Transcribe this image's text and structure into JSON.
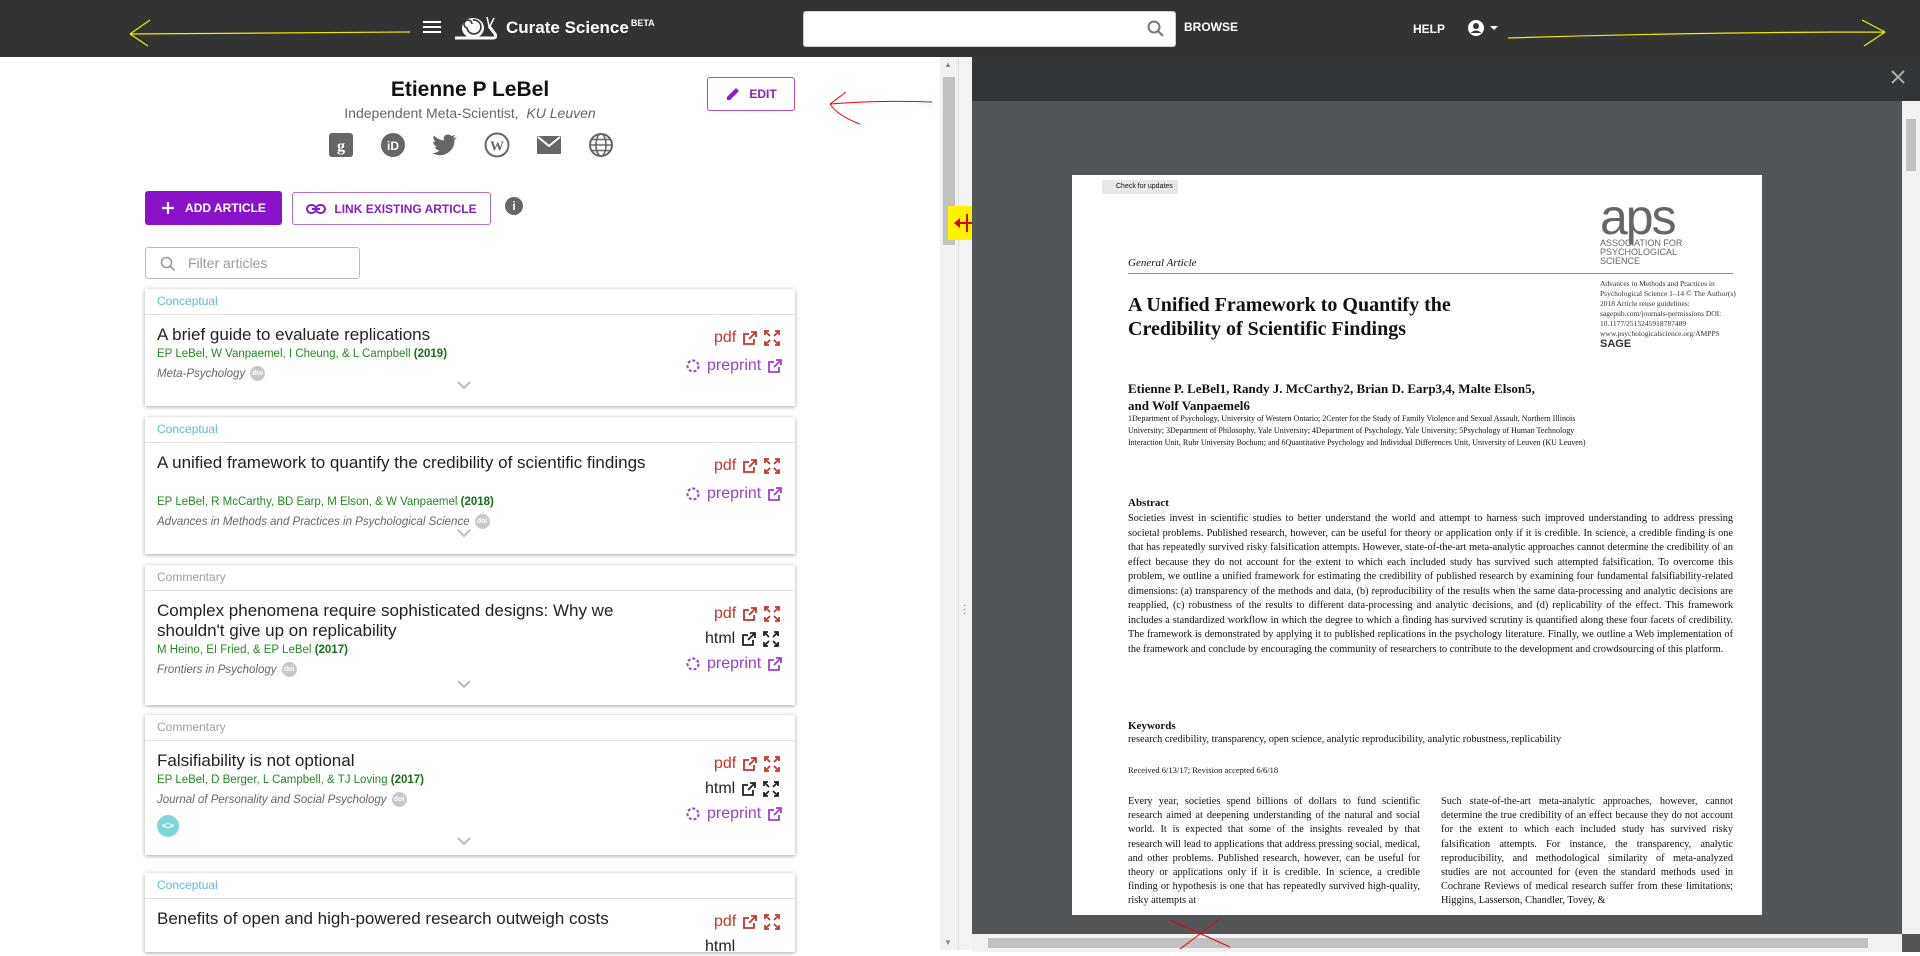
{
  "app": {
    "brand_name": "Curate Science",
    "brand_badge": "BETA",
    "search": {
      "value": "",
      "placeholder": ""
    },
    "browse_label": "BROWSE",
    "help_label": "HELP"
  },
  "profile": {
    "name": "Etienne P LeBel",
    "title": "Independent Meta-Scientist,",
    "institution": "KU Leuven",
    "edit_label": "EDIT",
    "social_icons": [
      "google-scholar-icon",
      "orcid-icon",
      "twitter-icon",
      "wordpress-icon",
      "email-icon",
      "website-globe-icon"
    ]
  },
  "actions": {
    "add_article": "ADD ARTICLE",
    "link_existing": "LINK EXISTING ARTICLE",
    "filter_placeholder": "Filter articles"
  },
  "colors": {
    "topbar": "#333333",
    "accent_purple": "#8a12c9",
    "type_conceptual": "#5bc0de",
    "type_commentary": "#9e9e9e",
    "authors_green": "#228b22",
    "pdf_red": "#c0392b",
    "preprint_purple": "#9b3fd0",
    "splitter_handle": "#fff200",
    "viewer_bg": "#525659"
  },
  "articles": [
    {
      "type": "Conceptual",
      "title": "A brief guide to evaluate replications",
      "authors": "EP LeBel, W Vanpaemel, I Cheung, & L Campbell",
      "year": "(2019)",
      "journal": "Meta-Psychology",
      "links": [
        "pdf",
        "preprint"
      ]
    },
    {
      "type": "Conceptual",
      "title": "A unified framework to quantify the credibility of scientific findings",
      "authors": "EP LeBel, R McCarthy, BD Earp, M Elson, & W Vanpaemel",
      "year": "(2018)",
      "journal": "Advances in Methods and Practices in Psychological Science",
      "links": [
        "pdf",
        "preprint"
      ]
    },
    {
      "type": "Commentary",
      "title": "Complex phenomena require sophisticated designs: Why we shouldn't give up on replicability",
      "authors": "M Heino, EI Fried, & EP LeBel",
      "year": "(2017)",
      "journal": "Frontiers in Psychology",
      "links": [
        "pdf",
        "html",
        "preprint"
      ]
    },
    {
      "type": "Commentary",
      "title": "Falsifiability is not optional",
      "authors": "EP LeBel, D Berger, L Campbell, & TJ Loving",
      "year": "(2017)",
      "journal": "Journal of Personality and Social Psychology",
      "links": [
        "pdf",
        "html",
        "preprint"
      ]
    },
    {
      "type": "Conceptual",
      "title": "Benefits of open and high-powered research outweigh costs",
      "links": [
        "pdf",
        "html"
      ]
    }
  ],
  "link_labels": {
    "pdf": "pdf",
    "html": "html",
    "preprint": "preprint"
  },
  "doi_badge": "doi",
  "pdf": {
    "check_updates": "Check for updates",
    "aps_logo": "aps",
    "aps_sub": "ASSOCIATION FOR PSYCHOLOGICAL SCIENCE",
    "article_type": "General Article",
    "meta_lines": "Advances in Methods and Practices in Psychological Science 1–14 © The Author(s) 2018 Article reuse guidelines: sagepub.com/journals-permissions DOI: 10.1177/2515245918787489 www.psychologicalscience.org/AMPPS",
    "sage": "SAGE",
    "title": "A Unified Framework to Quantify the Credibility of Scientific Findings",
    "authors": "Etienne P. LeBel1, Randy J. McCarthy2, Brian D. Earp3,4, Malte Elson5, and Wolf Vanpaemel6",
    "affiliations": "1Department of Psychology, University of Western Ontario; 2Center for the Study of Family Violence and Sexual Assault, Northern Illinois University; 3Department of Philosophy, Yale University; 4Department of Psychology, Yale University; 5Psychology of Human Technology Interaction Unit, Ruhr University Bochum; and 6Quantitative Psychology and Individual Differences Unit, University of Leuven (KU Leuven)",
    "abstract_heading": "Abstract",
    "abstract": "Societies invest in scientific studies to better understand the world and attempt to harness such improved understanding to address pressing societal problems. Published research, however, can be useful for theory or application only if it is credible. In science, a credible finding is one that has repeatedly survived risky falsification attempts. However, state-of-the-art meta-analytic approaches cannot determine the credibility of an effect because they do not account for the extent to which each included study has survived such attempted falsification. To overcome this problem, we outline a unified framework for estimating the credibility of published research by examining four fundamental falsifiability-related dimensions: (a) transparency of the methods and data, (b) reproducibility of the results when the same data-processing and analytic decisions are reapplied, (c) robustness of the results to different data-processing and analytic decisions, and (d) replicability of the effect. This framework includes a standardized workflow in which the degree to which a finding has survived scrutiny is quantified along these four facets of credibility. The framework is demonstrated by applying it to published replications in the psychology literature. Finally, we outline a Web implementation of the framework and conclude by encouraging the community of researchers to contribute to the development and crowdsourcing of this platform.",
    "keywords_heading": "Keywords",
    "keywords": "research credibility, transparency, open science, analytic reproducibility, analytic robustness, replicability",
    "received": "Received 6/13/17; Revision accepted 6/6/18",
    "col1": "Every year, societies spend billions of dollars to fund scientific research aimed at deepening understanding of the natural and social world. It is expected that some of the insights revealed by that research will lead to applications that address pressing social, medical, and other problems. Published research, however, can be useful for theory or applications only if it is credible. In science, a credible finding or hypothesis is one that has repeatedly survived high-quality, risky attempts at",
    "col2": "Such state-of-the-art meta-analytic approaches, however, cannot determine the true credibility of an effect because they do not account for the extent to which each included study has survived risky falsification attempts. For instance, the transparency, analytic reproducibility, and methodological similarity of meta-analyzed studies are not accounted for (even the standard methods used in Cochrane Reviews of medical research suffer from these limitations; Higgins, Lasserson, Chandler, Tovey, &"
  }
}
